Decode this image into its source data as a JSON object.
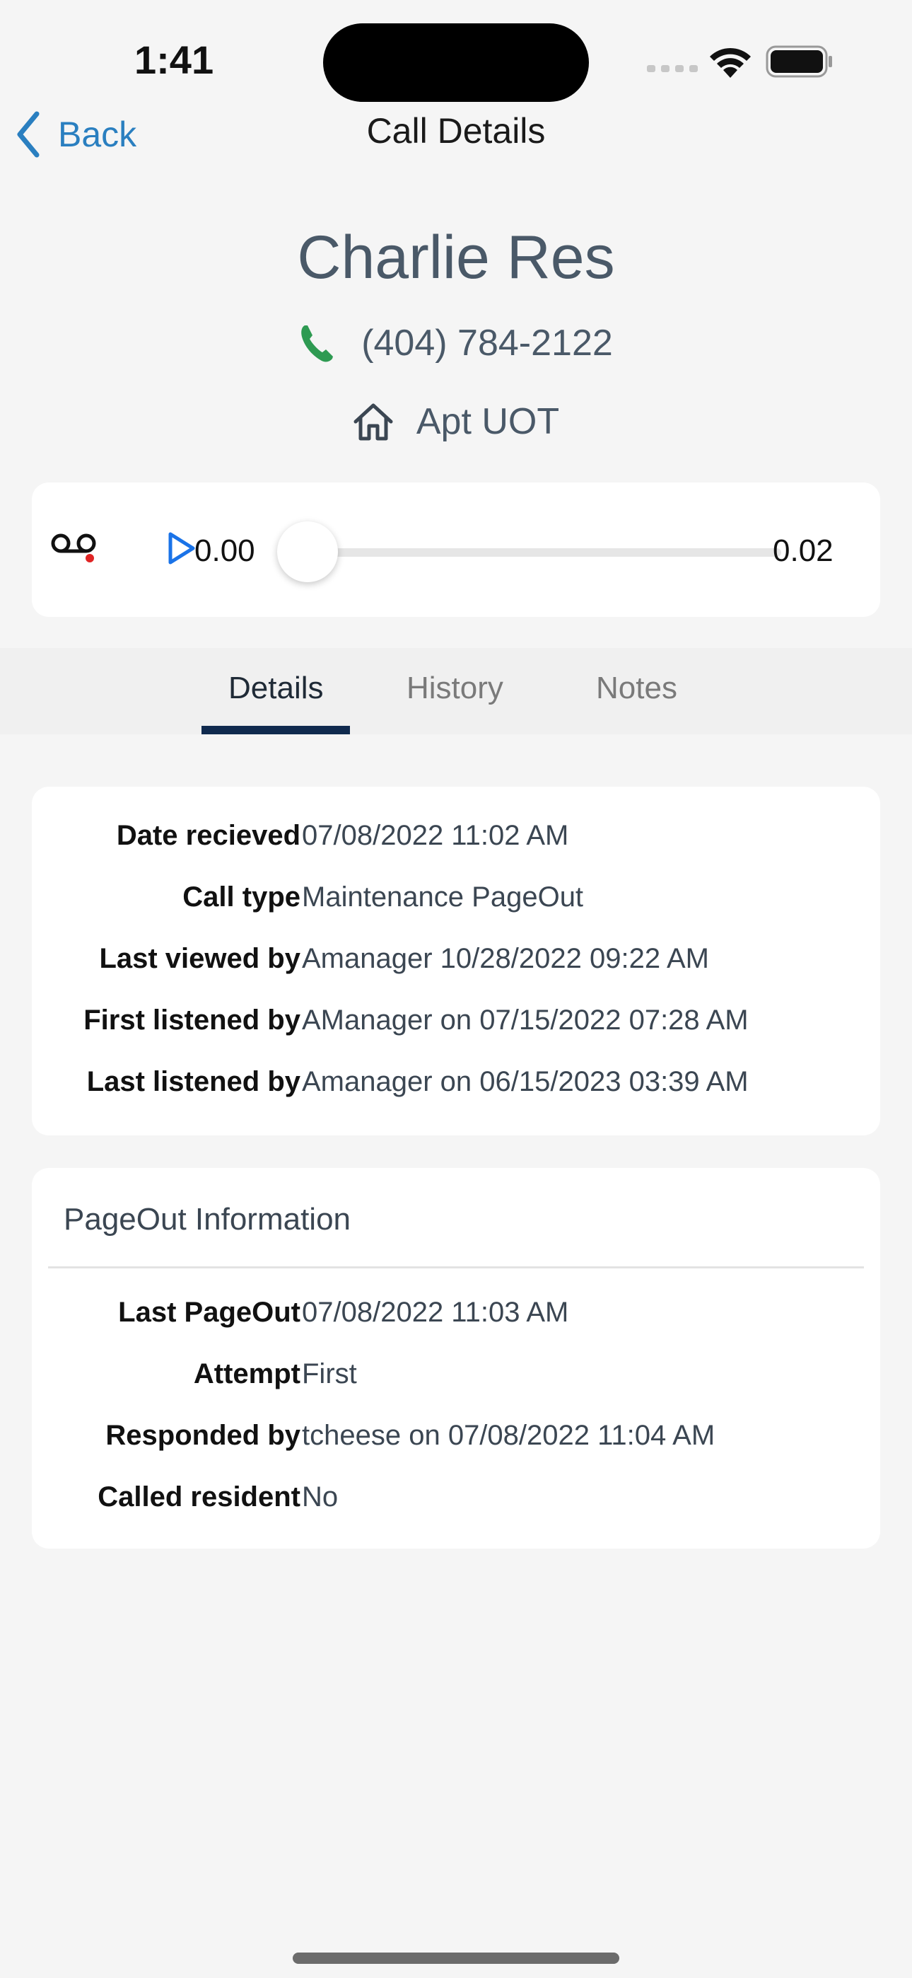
{
  "status_bar": {
    "time": "1:41"
  },
  "nav": {
    "back_label": "Back",
    "title": "Call Details"
  },
  "contact": {
    "name": "Charlie Res",
    "phone": "(404) 784-2122",
    "unit": "Apt UOT",
    "phone_icon_color": "#2e9a52"
  },
  "player": {
    "current_time": "0.00",
    "total_time": "0.02",
    "progress": 0.0,
    "accent_color": "#1a73e8"
  },
  "tabs": [
    {
      "label": "Details",
      "active": true
    },
    {
      "label": "History",
      "active": false
    },
    {
      "label": "Notes",
      "active": false
    }
  ],
  "details": [
    {
      "label": "Date recieved",
      "value": "07/08/2022 11:02 AM"
    },
    {
      "label": "Call type",
      "value": "Maintenance PageOut"
    },
    {
      "label": "Last viewed by",
      "value": "Amanager 10/28/2022 09:22 AM"
    },
    {
      "label": "First listened by",
      "value": "AManager on 07/15/2022 07:28 AM"
    },
    {
      "label": "Last listened by",
      "value": "Amanager on 06/15/2023 03:39 AM"
    }
  ],
  "pageout": {
    "title": "PageOut Information",
    "rows": [
      {
        "label": "Last PageOut",
        "value": "07/08/2022 11:03 AM"
      },
      {
        "label": "Attempt",
        "value": "First"
      },
      {
        "label": "Responded by",
        "value": "tcheese on 07/08/2022 11:04 AM"
      },
      {
        "label": "Called resident",
        "value": "No"
      }
    ]
  }
}
